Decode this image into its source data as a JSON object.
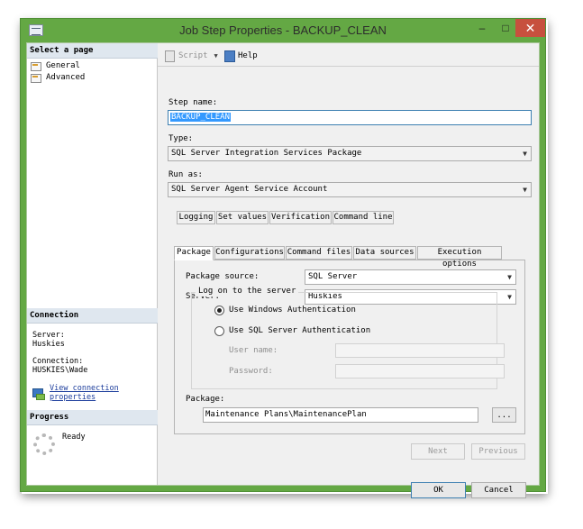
{
  "window": {
    "title": "Job Step Properties - BACKUP_CLEAN",
    "minimize": "–",
    "maximize": "□",
    "close": "✕"
  },
  "left": {
    "select_page_header": "Select a page",
    "pages": [
      {
        "label": "General"
      },
      {
        "label": "Advanced"
      }
    ],
    "connection_header": "Connection",
    "server_label": "Server:",
    "server_value": "Huskies",
    "connection_label": "Connection:",
    "connection_value": "HUSKIES\\Wade",
    "view_connection_line1": "View connection",
    "view_connection_line2": "properties",
    "progress_header": "Progress",
    "progress_status": "Ready"
  },
  "toolbar": {
    "script_label": "Script",
    "help_label": "Help"
  },
  "form": {
    "step_name_label": "Step name:",
    "step_name_value": "BACKUP_CLEAN",
    "type_label": "Type:",
    "type_value": "SQL Server Integration Services Package",
    "run_as_label": "Run as:",
    "run_as_value": "SQL Server Agent Service Account"
  },
  "tabs": {
    "row1": [
      "Logging",
      "Set values",
      "Verification",
      "Command line"
    ],
    "row2": [
      "Package",
      "Configurations",
      "Command files",
      "Data sources",
      "Execution options"
    ],
    "active": "Package"
  },
  "package_tab": {
    "source_label": "Package source:",
    "source_value": "SQL Server",
    "server_label": "Server:",
    "server_value": "Huskies",
    "logon_group_title": "Log on to the server",
    "windows_auth": "Use Windows Authentication",
    "sql_auth": "Use SQL Server Authentication",
    "auth_selected": "windows",
    "user_name_label": "User name:",
    "password_label": "Password:",
    "package_label": "Package:",
    "package_value": "Maintenance Plans\\MaintenancePlan",
    "browse_label": "..."
  },
  "nav_buttons": {
    "next": "Next",
    "previous": "Previous"
  },
  "dialog_buttons": {
    "ok": "OK",
    "cancel": "Cancel"
  },
  "icons": {
    "app": "job-step-icon",
    "page": "page-icon",
    "script": "script-icon",
    "help": "help-icon",
    "connection": "connection-properties-icon",
    "progress": "progress-spinner-icon"
  },
  "colors": {
    "window_frame": "#64a844",
    "close_button": "#c7503e",
    "selection": "#3399ff",
    "link": "#1c3d9c",
    "section_header": "#dfe7ef"
  }
}
